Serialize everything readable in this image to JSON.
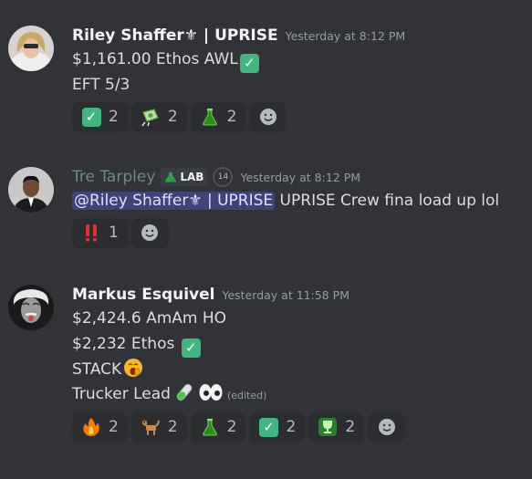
{
  "messages": [
    {
      "author": "Riley Shaffer⚜ | UPRISE",
      "timestamp": "Yesterday at 8:12 PM",
      "lines": [
        "$1,161.00 Ethos AWL",
        "EFT 5/3"
      ],
      "reactions": [
        {
          "emoji": "check-mark",
          "count": "2"
        },
        {
          "emoji": "money-with-wings",
          "count": "2"
        },
        {
          "emoji": "flask",
          "count": "2"
        }
      ]
    },
    {
      "author": "Tre Tarpley",
      "badge": "LAB",
      "badge2": "14",
      "timestamp": "Yesterday at 8:12 PM",
      "mention": "@Riley Shaffer⚜ | UPRISE",
      "text": " UPRISE Crew fina load up lol",
      "reactions": [
        {
          "emoji": "double-exclamation",
          "count": "1"
        }
      ]
    },
    {
      "author": "Markus Esquivel",
      "timestamp": "Yesterday at 11:58 PM",
      "lines": [
        "$2,424.6 AmAm HO",
        "$2,232 Ethos",
        "STACK",
        "Trucker Lead"
      ],
      "edited": "(edited)",
      "reactions": [
        {
          "emoji": "fire",
          "count": "2"
        },
        {
          "emoji": "dog",
          "count": "2"
        },
        {
          "emoji": "flask",
          "count": "2"
        },
        {
          "emoji": "check-mark",
          "count": "2"
        },
        {
          "emoji": "trophy",
          "count": "2"
        }
      ]
    }
  ],
  "colors": {
    "background": "#313338",
    "reaction_bg": "#2b2d31",
    "check_green": "#43b581",
    "mention_bg": "#3c4270"
  }
}
